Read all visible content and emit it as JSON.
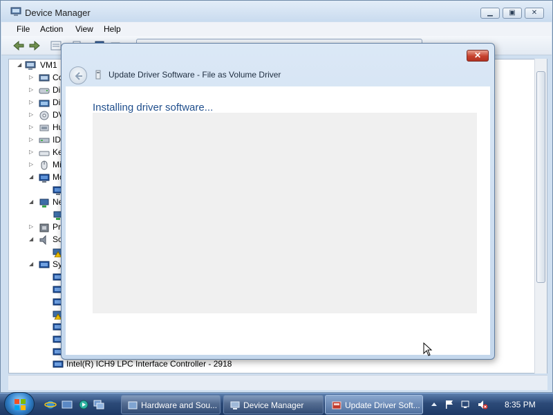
{
  "window": {
    "title": "Device Manager",
    "minimize_icon": "minimize-icon",
    "maximize_icon": "maximize-icon",
    "close_icon": "close-icon"
  },
  "menu": {
    "items": [
      "File",
      "Action",
      "View",
      "Help"
    ]
  },
  "tree": {
    "root_label": "VM1",
    "rows": [
      {
        "label": "Co",
        "icon": "computer-icon",
        "expander": "collapsed"
      },
      {
        "label": "Di",
        "icon": "disk-drive-icon",
        "expander": "collapsed"
      },
      {
        "label": "Di",
        "icon": "display-adapter-icon",
        "expander": "collapsed"
      },
      {
        "label": "DV",
        "icon": "dvd-drive-icon",
        "expander": "collapsed"
      },
      {
        "label": "Hu",
        "icon": "hid-icon",
        "expander": "collapsed"
      },
      {
        "label": "ID",
        "icon": "ide-controller-icon",
        "expander": "collapsed"
      },
      {
        "label": "Ke",
        "icon": "keyboard-icon",
        "expander": "collapsed"
      },
      {
        "label": "Mi",
        "icon": "mouse-icon",
        "expander": "collapsed"
      },
      {
        "label": "Mo",
        "icon": "monitor-icon",
        "expander": "expanded"
      },
      {
        "label": "",
        "icon": "monitor-icon",
        "expander": "none"
      },
      {
        "label": "Ne",
        "icon": "network-adapter-icon",
        "expander": "expanded"
      },
      {
        "label": "",
        "icon": "network-adapter-icon",
        "expander": "none"
      },
      {
        "label": "Pr",
        "icon": "processor-icon",
        "expander": "collapsed"
      },
      {
        "label": "So",
        "icon": "speaker-icon",
        "expander": "expanded"
      },
      {
        "label": "",
        "icon": "warning-device-icon",
        "expander": "none"
      },
      {
        "label": "Sy",
        "icon": "system-devices-icon",
        "expander": "expanded"
      },
      {
        "label": "",
        "icon": "system-device-icon",
        "expander": "none"
      },
      {
        "label": "",
        "icon": "system-device-icon",
        "expander": "none"
      },
      {
        "label": "",
        "icon": "system-device-icon",
        "expander": "none"
      },
      {
        "label": "",
        "icon": "warning-device-icon",
        "expander": "none"
      },
      {
        "label": "",
        "icon": "system-device-icon",
        "expander": "none"
      },
      {
        "label": "",
        "icon": "system-device-icon",
        "expander": "none"
      },
      {
        "label": "",
        "icon": "system-device-icon",
        "expander": "none"
      },
      {
        "label": "Intel(R) ICH9 LPC Interface Controller - 2918",
        "icon": "system-device-icon",
        "expander": "none"
      }
    ]
  },
  "dialog": {
    "title": "Update Driver Software - File as Volume Driver",
    "heading": "Installing driver software...",
    "close_label": "✕"
  },
  "taskbar": {
    "tasks": [
      {
        "label": "Hardware and Sou...",
        "icon": "control-panel-icon",
        "active": false
      },
      {
        "label": "Device Manager",
        "icon": "device-manager-icon",
        "active": false
      },
      {
        "label": "Update Driver Soft...",
        "icon": "update-driver-icon",
        "active": true
      }
    ],
    "clock": "8:35 PM"
  },
  "colors": {
    "dialog_heading": "#1f4e8c",
    "taskbar": "#2c4a78",
    "progress_area": "#f0f0f0"
  }
}
